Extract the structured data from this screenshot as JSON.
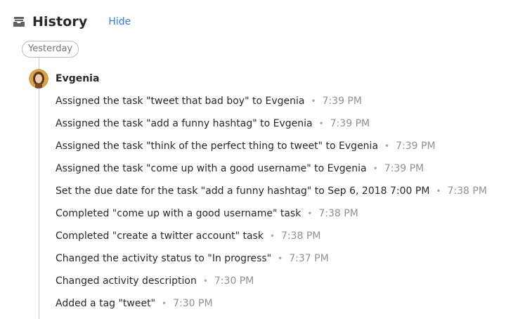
{
  "header": {
    "title": "History",
    "hide_label": "Hide"
  },
  "timeline": {
    "day_label": "Yesterday"
  },
  "user": {
    "name": "Evgenia"
  },
  "separator": "•",
  "entries": [
    {
      "text": "Assigned the task \"tweet that bad boy\" to Evgenia",
      "time": "7:39 PM"
    },
    {
      "text": "Assigned the task \"add a funny hashtag\" to Evgenia",
      "time": "7:39 PM"
    },
    {
      "text": "Assigned the task \"think of the perfect thing to tweet\" to Evgenia",
      "time": "7:39 PM"
    },
    {
      "text": "Assigned the task \"come up with a good username\" to Evgenia",
      "time": "7:39 PM"
    },
    {
      "text": "Set the due date for the task \"add a funny hashtag\" to Sep 6, 2018 7:00 PM",
      "time": "7:38 PM"
    },
    {
      "text": "Completed \"come up with a good username\" task",
      "time": "7:38 PM"
    },
    {
      "text": "Completed \"create a twitter account\" task",
      "time": "7:38 PM"
    },
    {
      "text": "Changed the activity status to \"In progress\"",
      "time": "7:37 PM"
    },
    {
      "text": "Changed activity description",
      "time": "7:30 PM"
    },
    {
      "text": "Added a tag \"tweet\"",
      "time": "7:30 PM"
    }
  ],
  "icons": {
    "history": "inbox-tray-icon",
    "avatar": "user-avatar"
  },
  "colors": {
    "link": "#317ae2",
    "text": "#26292c",
    "muted": "#8e9195",
    "line": "#c9cbce"
  }
}
